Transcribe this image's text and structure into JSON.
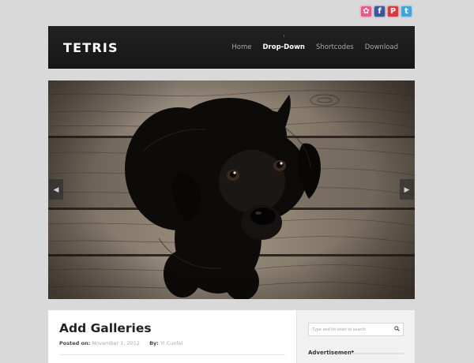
{
  "social": [
    {
      "name": "dribbble-icon",
      "glyph": "✿",
      "color": "#e8598c"
    },
    {
      "name": "facebook-icon",
      "glyph": "f",
      "color": "#3b5998"
    },
    {
      "name": "pinterest-icon",
      "glyph": "P",
      "color": "#d8383e"
    },
    {
      "name": "twitter-icon",
      "glyph": "t",
      "color": "#41a5d8"
    }
  ],
  "header": {
    "logo": "TETRIS",
    "nav": [
      {
        "label": "Home",
        "active": false
      },
      {
        "label": "Drop-Down",
        "active": true
      },
      {
        "label": "Shortcodes",
        "active": false
      },
      {
        "label": "Download",
        "active": false
      }
    ]
  },
  "slider": {
    "prev_glyph": "◀",
    "next_glyph": "▶",
    "image": "black puppy on wooden floor"
  },
  "post": {
    "title": "Add Galleries",
    "posted_on_label": "Posted on:",
    "posted_on_value": "November 1, 2012",
    "by_label": "By:",
    "by_value": "Yi Cuofei"
  },
  "sidebar": {
    "search_placeholder": "Type and hit enter to search",
    "ad_heading": "Advertisement"
  },
  "colors": {
    "background": "#d9d9d9",
    "header": "#1b1b1b",
    "nav_active": "#ffffff",
    "nav_inactive": "#a8a8a8"
  }
}
